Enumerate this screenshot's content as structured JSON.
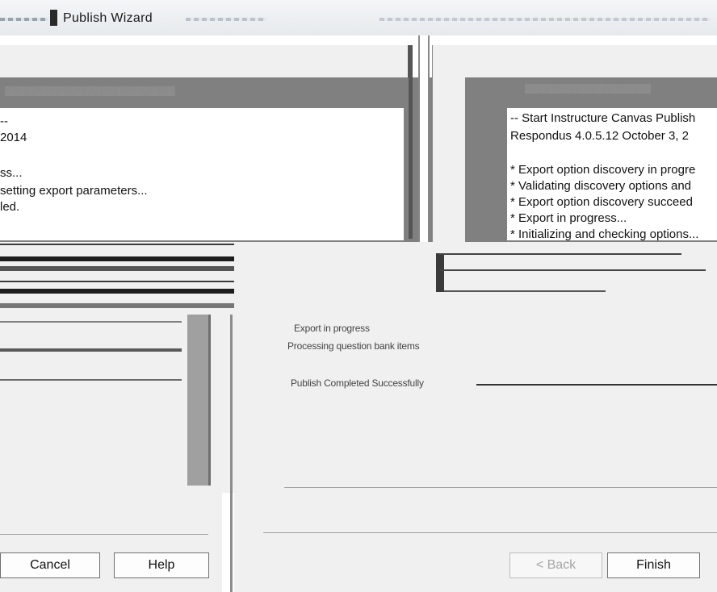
{
  "window": {
    "title": "Publish Wizard"
  },
  "left_panel": {
    "log_lines": [
      "--",
      "2014",
      "",
      "ss...",
      " setting export parameters...",
      "led."
    ]
  },
  "right_panel": {
    "log_lines": [
      "-- Start Instructure Canvas Publish",
      "Respondus 4.0.5.12  October 3, 2",
      "",
      "* Export option discovery in progre",
      "* Validating discovery options and",
      "* Export option discovery succeed",
      "* Export in progress...",
      "* Initializing and checking options..."
    ],
    "progress_lines": [
      "Export in progress",
      "Processing question bank items",
      "Publish Completed Successfully"
    ]
  },
  "buttons": {
    "cancel": "Cancel",
    "help": "Help",
    "back": "< Back",
    "finish": "Finish"
  }
}
